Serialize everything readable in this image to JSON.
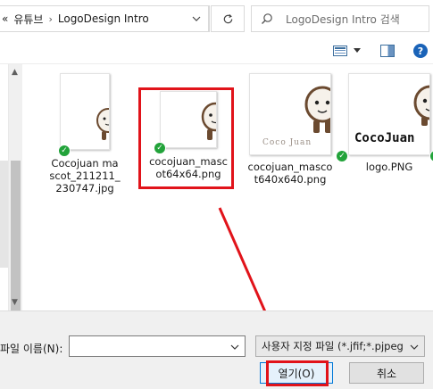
{
  "address_bar": {
    "crumbs": [
      "«",
      "유튜브",
      "LogoDesign Intro"
    ],
    "separator": "›"
  },
  "search": {
    "placeholder": "LogoDesign Intro 검색"
  },
  "toolbar": {
    "help_label": "?"
  },
  "files": [
    {
      "name": "Cocojuan mascot_211211_230747.jpg",
      "thumb_caption": "",
      "synced": true,
      "highlighted": false
    },
    {
      "name": "cocojuan_mascot64x64.png",
      "thumb_caption": "",
      "synced": true,
      "highlighted": true
    },
    {
      "name": "cocojuan_mascot640x640.png",
      "thumb_caption": "Coco Juan",
      "synced": true,
      "highlighted": false
    },
    {
      "name": "logo.PNG",
      "thumb_caption": "CocoJuan",
      "synced": true,
      "highlighted": false
    }
  ],
  "bottom": {
    "file_name_label": "파일 이름(N):",
    "file_name_value": "",
    "file_type_value": "사용자 지정 파일 (*.jfif;*.pjpeg",
    "open_label": "열기(O)",
    "cancel_label": "취소"
  },
  "colors": {
    "highlight": "#e1131a",
    "sync_check": "#22a33a",
    "help_icon": "#1a63b8"
  }
}
